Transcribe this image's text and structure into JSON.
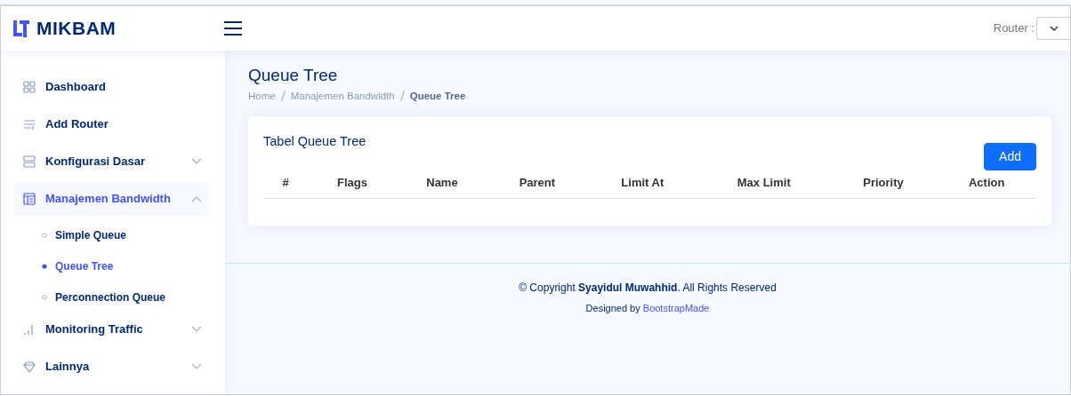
{
  "header": {
    "logo": "MIKBAM",
    "router_label": "Router :"
  },
  "sidebar": {
    "items": [
      {
        "label": "Dashboard",
        "selected": false
      },
      {
        "label": "Add Router",
        "selected": false
      },
      {
        "label": "Konfigurasi Dasar",
        "selected": false,
        "expanded": false
      },
      {
        "label": "Manajemen Bandwidth",
        "selected": true,
        "expanded": true,
        "children": [
          {
            "label": "Simple Queue",
            "selected": false
          },
          {
            "label": "Queue Tree",
            "selected": true
          },
          {
            "label": "Perconnection Queue",
            "selected": false
          }
        ]
      },
      {
        "label": "Monitoring Traffic",
        "selected": false,
        "expanded": false
      },
      {
        "label": "Lainnya",
        "selected": false,
        "expanded": false
      }
    ]
  },
  "page": {
    "title": "Queue Tree",
    "breadcrumb": [
      "Home",
      "Manajemen Bandwidth",
      "Queue Tree"
    ]
  },
  "card": {
    "title": "Tabel Queue Tree",
    "add_button": "Add",
    "table": {
      "columns": [
        "#",
        "Flags",
        "Name",
        "Parent",
        "Limit At",
        "Max Limit",
        "Priority",
        "Action"
      ]
    }
  },
  "footer": {
    "copyright": "© Copyright **Syayidul Muwahhid**. All Rights Reserved",
    "designed_by": "Designed by",
    "designer_link": "BootstrapMade"
  }
}
